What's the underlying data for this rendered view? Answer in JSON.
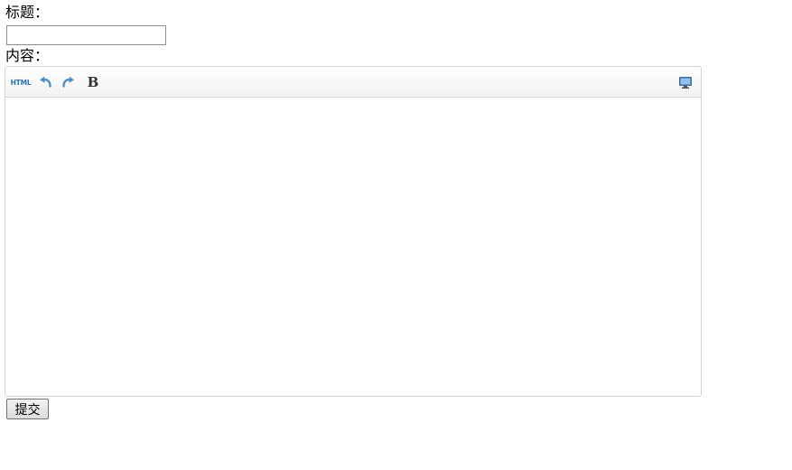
{
  "form": {
    "title_label": "标题：",
    "title_value": "",
    "content_label": "内容：",
    "submit_label": "提交"
  },
  "editor": {
    "toolbar": {
      "html_label": "HTML",
      "undo_icon": "undo-icon",
      "redo_icon": "redo-icon",
      "bold_label": "B",
      "fullscreen_icon": "fullscreen-icon"
    },
    "content": ""
  },
  "colors": {
    "icon_blue": "#2f6fb3",
    "toolbar_border": "#d9d9d9"
  }
}
